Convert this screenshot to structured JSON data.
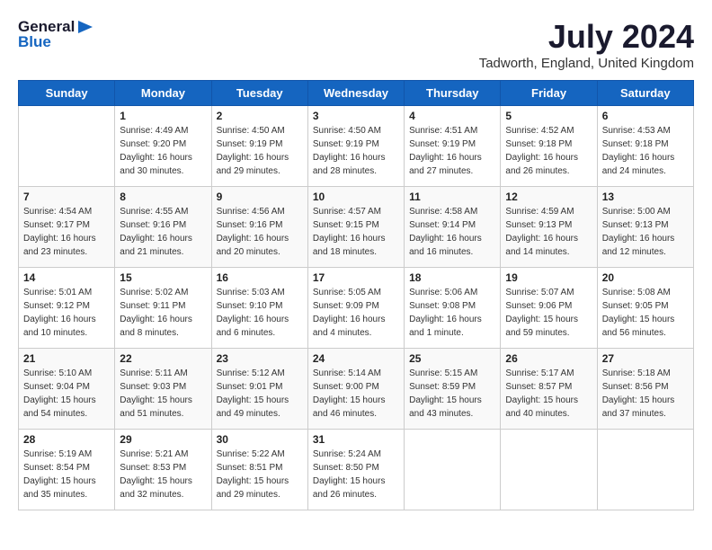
{
  "header": {
    "logo_general": "General",
    "logo_blue": "Blue",
    "month_year": "July 2024",
    "location": "Tadworth, England, United Kingdom"
  },
  "weekdays": [
    "Sunday",
    "Monday",
    "Tuesday",
    "Wednesday",
    "Thursday",
    "Friday",
    "Saturday"
  ],
  "weeks": [
    [
      {
        "day": "",
        "info": ""
      },
      {
        "day": "1",
        "info": "Sunrise: 4:49 AM\nSunset: 9:20 PM\nDaylight: 16 hours\nand 30 minutes."
      },
      {
        "day": "2",
        "info": "Sunrise: 4:50 AM\nSunset: 9:19 PM\nDaylight: 16 hours\nand 29 minutes."
      },
      {
        "day": "3",
        "info": "Sunrise: 4:50 AM\nSunset: 9:19 PM\nDaylight: 16 hours\nand 28 minutes."
      },
      {
        "day": "4",
        "info": "Sunrise: 4:51 AM\nSunset: 9:19 PM\nDaylight: 16 hours\nand 27 minutes."
      },
      {
        "day": "5",
        "info": "Sunrise: 4:52 AM\nSunset: 9:18 PM\nDaylight: 16 hours\nand 26 minutes."
      },
      {
        "day": "6",
        "info": "Sunrise: 4:53 AM\nSunset: 9:18 PM\nDaylight: 16 hours\nand 24 minutes."
      }
    ],
    [
      {
        "day": "7",
        "info": "Sunrise: 4:54 AM\nSunset: 9:17 PM\nDaylight: 16 hours\nand 23 minutes."
      },
      {
        "day": "8",
        "info": "Sunrise: 4:55 AM\nSunset: 9:16 PM\nDaylight: 16 hours\nand 21 minutes."
      },
      {
        "day": "9",
        "info": "Sunrise: 4:56 AM\nSunset: 9:16 PM\nDaylight: 16 hours\nand 20 minutes."
      },
      {
        "day": "10",
        "info": "Sunrise: 4:57 AM\nSunset: 9:15 PM\nDaylight: 16 hours\nand 18 minutes."
      },
      {
        "day": "11",
        "info": "Sunrise: 4:58 AM\nSunset: 9:14 PM\nDaylight: 16 hours\nand 16 minutes."
      },
      {
        "day": "12",
        "info": "Sunrise: 4:59 AM\nSunset: 9:13 PM\nDaylight: 16 hours\nand 14 minutes."
      },
      {
        "day": "13",
        "info": "Sunrise: 5:00 AM\nSunset: 9:13 PM\nDaylight: 16 hours\nand 12 minutes."
      }
    ],
    [
      {
        "day": "14",
        "info": "Sunrise: 5:01 AM\nSunset: 9:12 PM\nDaylight: 16 hours\nand 10 minutes."
      },
      {
        "day": "15",
        "info": "Sunrise: 5:02 AM\nSunset: 9:11 PM\nDaylight: 16 hours\nand 8 minutes."
      },
      {
        "day": "16",
        "info": "Sunrise: 5:03 AM\nSunset: 9:10 PM\nDaylight: 16 hours\nand 6 minutes."
      },
      {
        "day": "17",
        "info": "Sunrise: 5:05 AM\nSunset: 9:09 PM\nDaylight: 16 hours\nand 4 minutes."
      },
      {
        "day": "18",
        "info": "Sunrise: 5:06 AM\nSunset: 9:08 PM\nDaylight: 16 hours\nand 1 minute."
      },
      {
        "day": "19",
        "info": "Sunrise: 5:07 AM\nSunset: 9:06 PM\nDaylight: 15 hours\nand 59 minutes."
      },
      {
        "day": "20",
        "info": "Sunrise: 5:08 AM\nSunset: 9:05 PM\nDaylight: 15 hours\nand 56 minutes."
      }
    ],
    [
      {
        "day": "21",
        "info": "Sunrise: 5:10 AM\nSunset: 9:04 PM\nDaylight: 15 hours\nand 54 minutes."
      },
      {
        "day": "22",
        "info": "Sunrise: 5:11 AM\nSunset: 9:03 PM\nDaylight: 15 hours\nand 51 minutes."
      },
      {
        "day": "23",
        "info": "Sunrise: 5:12 AM\nSunset: 9:01 PM\nDaylight: 15 hours\nand 49 minutes."
      },
      {
        "day": "24",
        "info": "Sunrise: 5:14 AM\nSunset: 9:00 PM\nDaylight: 15 hours\nand 46 minutes."
      },
      {
        "day": "25",
        "info": "Sunrise: 5:15 AM\nSunset: 8:59 PM\nDaylight: 15 hours\nand 43 minutes."
      },
      {
        "day": "26",
        "info": "Sunrise: 5:17 AM\nSunset: 8:57 PM\nDaylight: 15 hours\nand 40 minutes."
      },
      {
        "day": "27",
        "info": "Sunrise: 5:18 AM\nSunset: 8:56 PM\nDaylight: 15 hours\nand 37 minutes."
      }
    ],
    [
      {
        "day": "28",
        "info": "Sunrise: 5:19 AM\nSunset: 8:54 PM\nDaylight: 15 hours\nand 35 minutes."
      },
      {
        "day": "29",
        "info": "Sunrise: 5:21 AM\nSunset: 8:53 PM\nDaylight: 15 hours\nand 32 minutes."
      },
      {
        "day": "30",
        "info": "Sunrise: 5:22 AM\nSunset: 8:51 PM\nDaylight: 15 hours\nand 29 minutes."
      },
      {
        "day": "31",
        "info": "Sunrise: 5:24 AM\nSunset: 8:50 PM\nDaylight: 15 hours\nand 26 minutes."
      },
      {
        "day": "",
        "info": ""
      },
      {
        "day": "",
        "info": ""
      },
      {
        "day": "",
        "info": ""
      }
    ]
  ]
}
